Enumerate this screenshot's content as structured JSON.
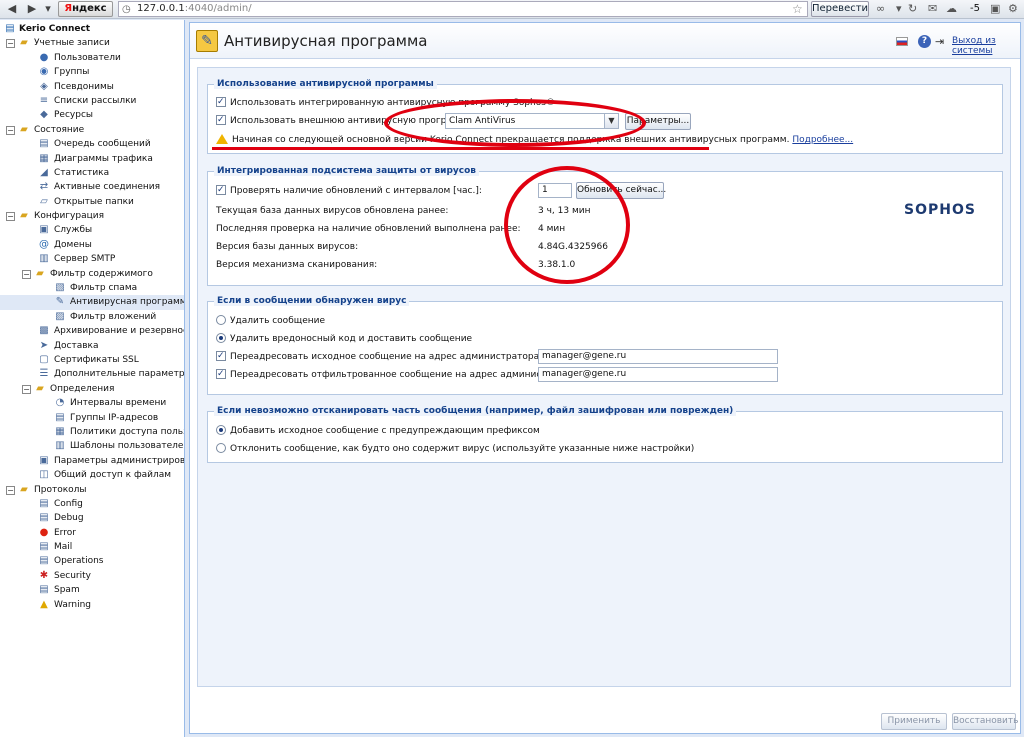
{
  "browser": {
    "yandex_label_y": "Я",
    "yandex_label_rest": "ндекс",
    "url_host": "127.0.0.1",
    "url_rest": ":4040/admin/",
    "translate_label": "Перевести",
    "temperature": "-5"
  },
  "sidebar": {
    "root": "Kerio Connect",
    "items": [
      {
        "label": "Учетные записи",
        "level": 1,
        "toggle": "−",
        "icon": "folder-icon"
      },
      {
        "label": "Пользователи",
        "level": 2,
        "icon": "user-icon"
      },
      {
        "label": "Группы",
        "level": 2,
        "icon": "group-icon"
      },
      {
        "label": "Псевдонимы",
        "level": 2,
        "icon": "alias-icon"
      },
      {
        "label": "Списки рассылки",
        "level": 2,
        "icon": "mailing-list-icon"
      },
      {
        "label": "Ресурсы",
        "level": 2,
        "icon": "resource-icon"
      },
      {
        "label": "Состояние",
        "level": 1,
        "toggle": "−",
        "icon": "folder-icon"
      },
      {
        "label": "Очередь сообщений",
        "level": 2,
        "icon": "queue-icon"
      },
      {
        "label": "Диаграммы трафика",
        "level": 2,
        "icon": "chart-icon"
      },
      {
        "label": "Статистика",
        "level": 2,
        "icon": "stats-icon"
      },
      {
        "label": "Активные соединения",
        "level": 2,
        "icon": "connections-icon"
      },
      {
        "label": "Открытые папки",
        "level": 2,
        "icon": "open-folder-icon"
      },
      {
        "label": "Конфигурация",
        "level": 1,
        "toggle": "−",
        "icon": "folder-icon"
      },
      {
        "label": "Службы",
        "level": 2,
        "icon": "services-icon"
      },
      {
        "label": "Домены",
        "level": 2,
        "icon": "at-icon"
      },
      {
        "label": "Сервер SMTP",
        "level": 2,
        "icon": "smtp-icon"
      },
      {
        "label": "Фильтр содержимого",
        "level": 2,
        "toggle": "−",
        "icon": "folder-icon"
      },
      {
        "label": "Фильтр спама",
        "level": 3,
        "icon": "spam-filter-icon"
      },
      {
        "label": "Антивирусная программа",
        "level": 3,
        "icon": "antivirus-icon",
        "selected": true
      },
      {
        "label": "Фильтр вложений",
        "level": 3,
        "icon": "attachment-filter-icon"
      },
      {
        "label": "Архивирование и резервное копирование",
        "level": 2,
        "icon": "archive-icon"
      },
      {
        "label": "Доставка",
        "level": 2,
        "icon": "delivery-icon"
      },
      {
        "label": "Сертификаты SSL",
        "level": 2,
        "icon": "certificate-icon"
      },
      {
        "label": "Дополнительные параметры",
        "level": 2,
        "icon": "advanced-icon"
      },
      {
        "label": "Определения",
        "level": 2,
        "toggle": "−",
        "icon": "folder-icon"
      },
      {
        "label": "Интервалы времени",
        "level": 3,
        "icon": "time-icon"
      },
      {
        "label": "Группы IP-адресов",
        "level": 3,
        "icon": "ip-group-icon"
      },
      {
        "label": "Политики доступа пользователей",
        "level": 3,
        "icon": "policy-icon"
      },
      {
        "label": "Шаблоны пользователей",
        "level": 3,
        "icon": "template-icon"
      },
      {
        "label": "Параметры администрирования",
        "level": 2,
        "icon": "admin-icon"
      },
      {
        "label": "Общий доступ к файлам",
        "level": 2,
        "icon": "share-icon"
      },
      {
        "label": "Протоколы",
        "level": 1,
        "toggle": "−",
        "icon": "folder-icon"
      },
      {
        "label": "Config",
        "level": 2,
        "icon": "log-icon"
      },
      {
        "label": "Debug",
        "level": 2,
        "icon": "log-icon"
      },
      {
        "label": "Error",
        "level": 2,
        "icon": "error-icon"
      },
      {
        "label": "Mail",
        "level": 2,
        "icon": "log-icon"
      },
      {
        "label": "Operations",
        "level": 2,
        "icon": "log-icon"
      },
      {
        "label": "Security",
        "level": 2,
        "icon": "security-icon"
      },
      {
        "label": "Spam",
        "level": 2,
        "icon": "log-icon"
      },
      {
        "label": "Warning",
        "level": 2,
        "icon": "warning-icon"
      }
    ]
  },
  "header": {
    "title": "Антивирусная программа",
    "logout": "Выход из системы"
  },
  "usage": {
    "legend": "Использование антивирусной программы",
    "use_integrated": "Использовать интегрированную антивирусную программу Sophos®",
    "use_external": "Использовать внешнюю антивирусную программу",
    "external_select": "Clam AntiVirus",
    "params_button": "Параметры...",
    "warning": "Начиная со следующей основной версии Kerio Connect прекращается поддержка внешних антивирусных программ.",
    "more_link": "Подробнее..."
  },
  "integrated": {
    "legend": "Интегрированная подсистема защиты от вирусов",
    "check_updates": "Проверять наличие обновлений с интервалом [час.]:",
    "interval": "1",
    "update_button": "Обновить сейчас...",
    "db_updated_label": "Текущая база данных вирусов обновлена ранее:",
    "db_updated_value": "3 ч, 13 мин",
    "last_check_label": "Последняя проверка на наличие обновлений выполнена ранее:",
    "last_check_value": "4 мин",
    "db_version_label": "Версия базы данных вирусов:",
    "db_version_value": "4.84G.4325966",
    "engine_version_label": "Версия механизма сканирования:",
    "engine_version_value": "3.38.1.0",
    "logo": "SOPHOS"
  },
  "virus_found": {
    "legend": "Если в сообщении обнаружен вирус",
    "delete": "Удалить сообщение",
    "remove_deliver": "Удалить вредоносный код и доставить сообщение",
    "forward_original": "Переадресовать исходное сообщение на адрес администратора:",
    "forward_original_value": "manager@gene.ru",
    "forward_filtered": "Переадресовать отфильтрованное сообщение на адрес администратора:",
    "forward_filtered_value": "manager@gene.ru"
  },
  "unscannable": {
    "legend": "Если невозможно отсканировать часть сообщения (например, файл зашифрован или поврежден)",
    "add_prefix": "Добавить исходное сообщение с предупреждающим префиксом",
    "reject": "Отклонить сообщение, как будто оно содержит вирус (используйте указанные ниже настройки)"
  },
  "footer": {
    "apply": "Применить",
    "restore": "Восстановить"
  },
  "colors": {
    "annotation": "#e00010",
    "accent": "#15428b"
  }
}
